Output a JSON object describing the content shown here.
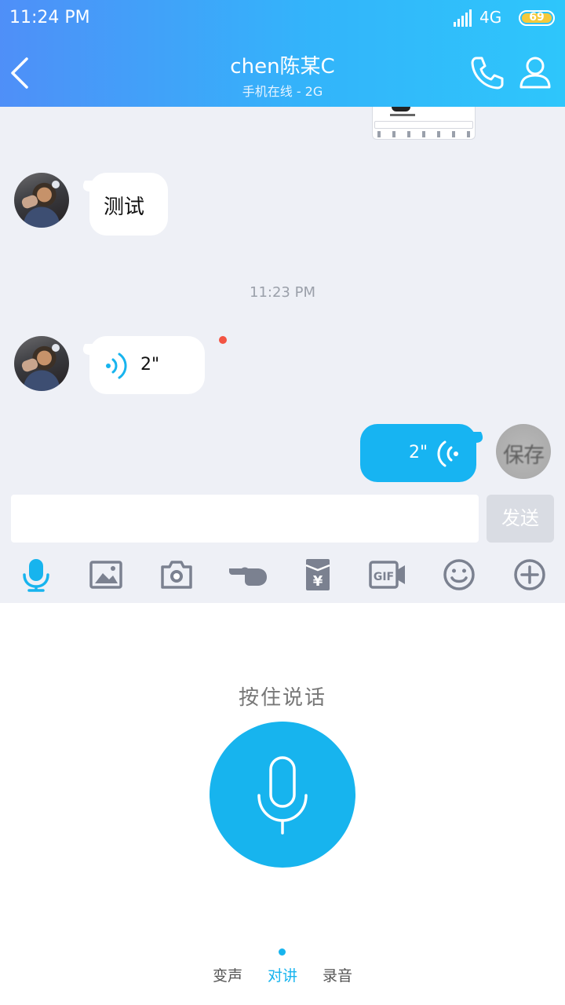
{
  "status_bar": {
    "time": "11:24 PM",
    "network": "4G",
    "battery": "69"
  },
  "header": {
    "title": "chen陈某C",
    "subtitle": "手机在线 - 2G"
  },
  "messages": [
    {
      "type": "text",
      "direction": "in",
      "text": "测试"
    },
    {
      "type": "timestamp",
      "text": "11:23 PM"
    },
    {
      "type": "voice",
      "direction": "in",
      "duration": "2\""
    },
    {
      "type": "voice",
      "direction": "out",
      "duration": "2\"",
      "avatar_text": "保存"
    }
  ],
  "input": {
    "placeholder": "",
    "send_label": "发送"
  },
  "toolbar": [
    "mic-icon",
    "image-icon",
    "camera-icon",
    "poke-icon",
    "red-packet-icon",
    "gif-icon",
    "emoji-icon",
    "plus-icon"
  ],
  "voice_panel": {
    "hold_label": "按住说话",
    "modes": [
      "变声",
      "对讲",
      "录音"
    ],
    "active_mode": "对讲"
  },
  "colors": {
    "accent": "#17b4ee",
    "header_start": "#4f8ff8",
    "header_end": "#2ec6fb",
    "unread": "#f35443"
  }
}
